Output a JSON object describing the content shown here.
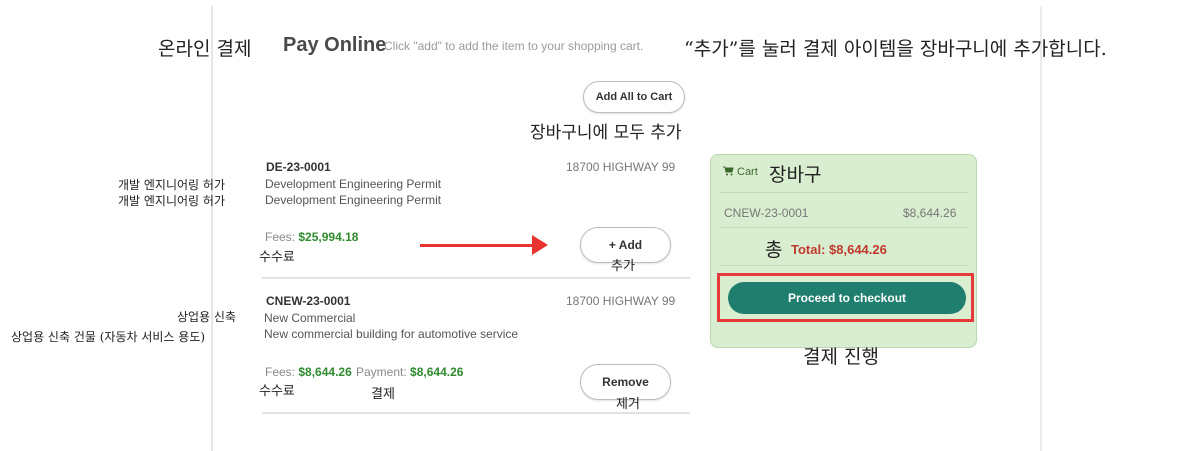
{
  "header": {
    "title_ko": "온라인 결제",
    "title_en": "Pay Online",
    "hint_en": "Click \"add\" to add the item to your shopping cart.",
    "hint_ko": "“추가”를 눌러 결제 아이템을 장바구니에 추가합니다."
  },
  "add_all": {
    "label": "Add All to Cart",
    "label_ko": "장바구니에 모두 추가"
  },
  "permits": [
    {
      "id": "DE-23-0001",
      "type": "Development Engineering Permit",
      "type_ko": "개발 엔지니어링 허가",
      "description": "Development Engineering Permit",
      "description_ko": "개발 엔지니어링 허가",
      "address": "18700 HIGHWAY 99",
      "fees_label": "Fees:",
      "fees_value": "$25,994.18",
      "fees_ko": "수수료",
      "action_label": "+ Add",
      "action_ko": "추가"
    },
    {
      "id": "CNEW-23-0001",
      "type": "New Commercial",
      "type_ko": "상업용 신축",
      "description": "New commercial building for automotive service",
      "description_ko": "상업용 신축 건물 (자동차 서비스 용도)",
      "address": "18700 HIGHWAY 99",
      "fees_label": "Fees:",
      "fees_value": "$8,644.26",
      "fees_ko": "수수료",
      "payment_label": "Payment:",
      "payment_value": "$8,644.26",
      "payment_ko": "결제",
      "action_label": "Remove",
      "action_ko": "제거"
    }
  ],
  "cart": {
    "icon": "cart-icon",
    "title": "Cart",
    "title_ko": "장바구",
    "item_id": "CNEW-23-0001",
    "item_amount": "$8,644.26",
    "total_ko": "총",
    "total": "Total: $8,644.26",
    "checkout_label": "Proceed to checkout",
    "checkout_ko": "결제 진행"
  },
  "colors": {
    "accent": "#1f7e6e",
    "fees": "#2e8b2e",
    "total": "#c0392b",
    "highlight": "#e63a3a",
    "cart_bg": "#d9edd0"
  }
}
